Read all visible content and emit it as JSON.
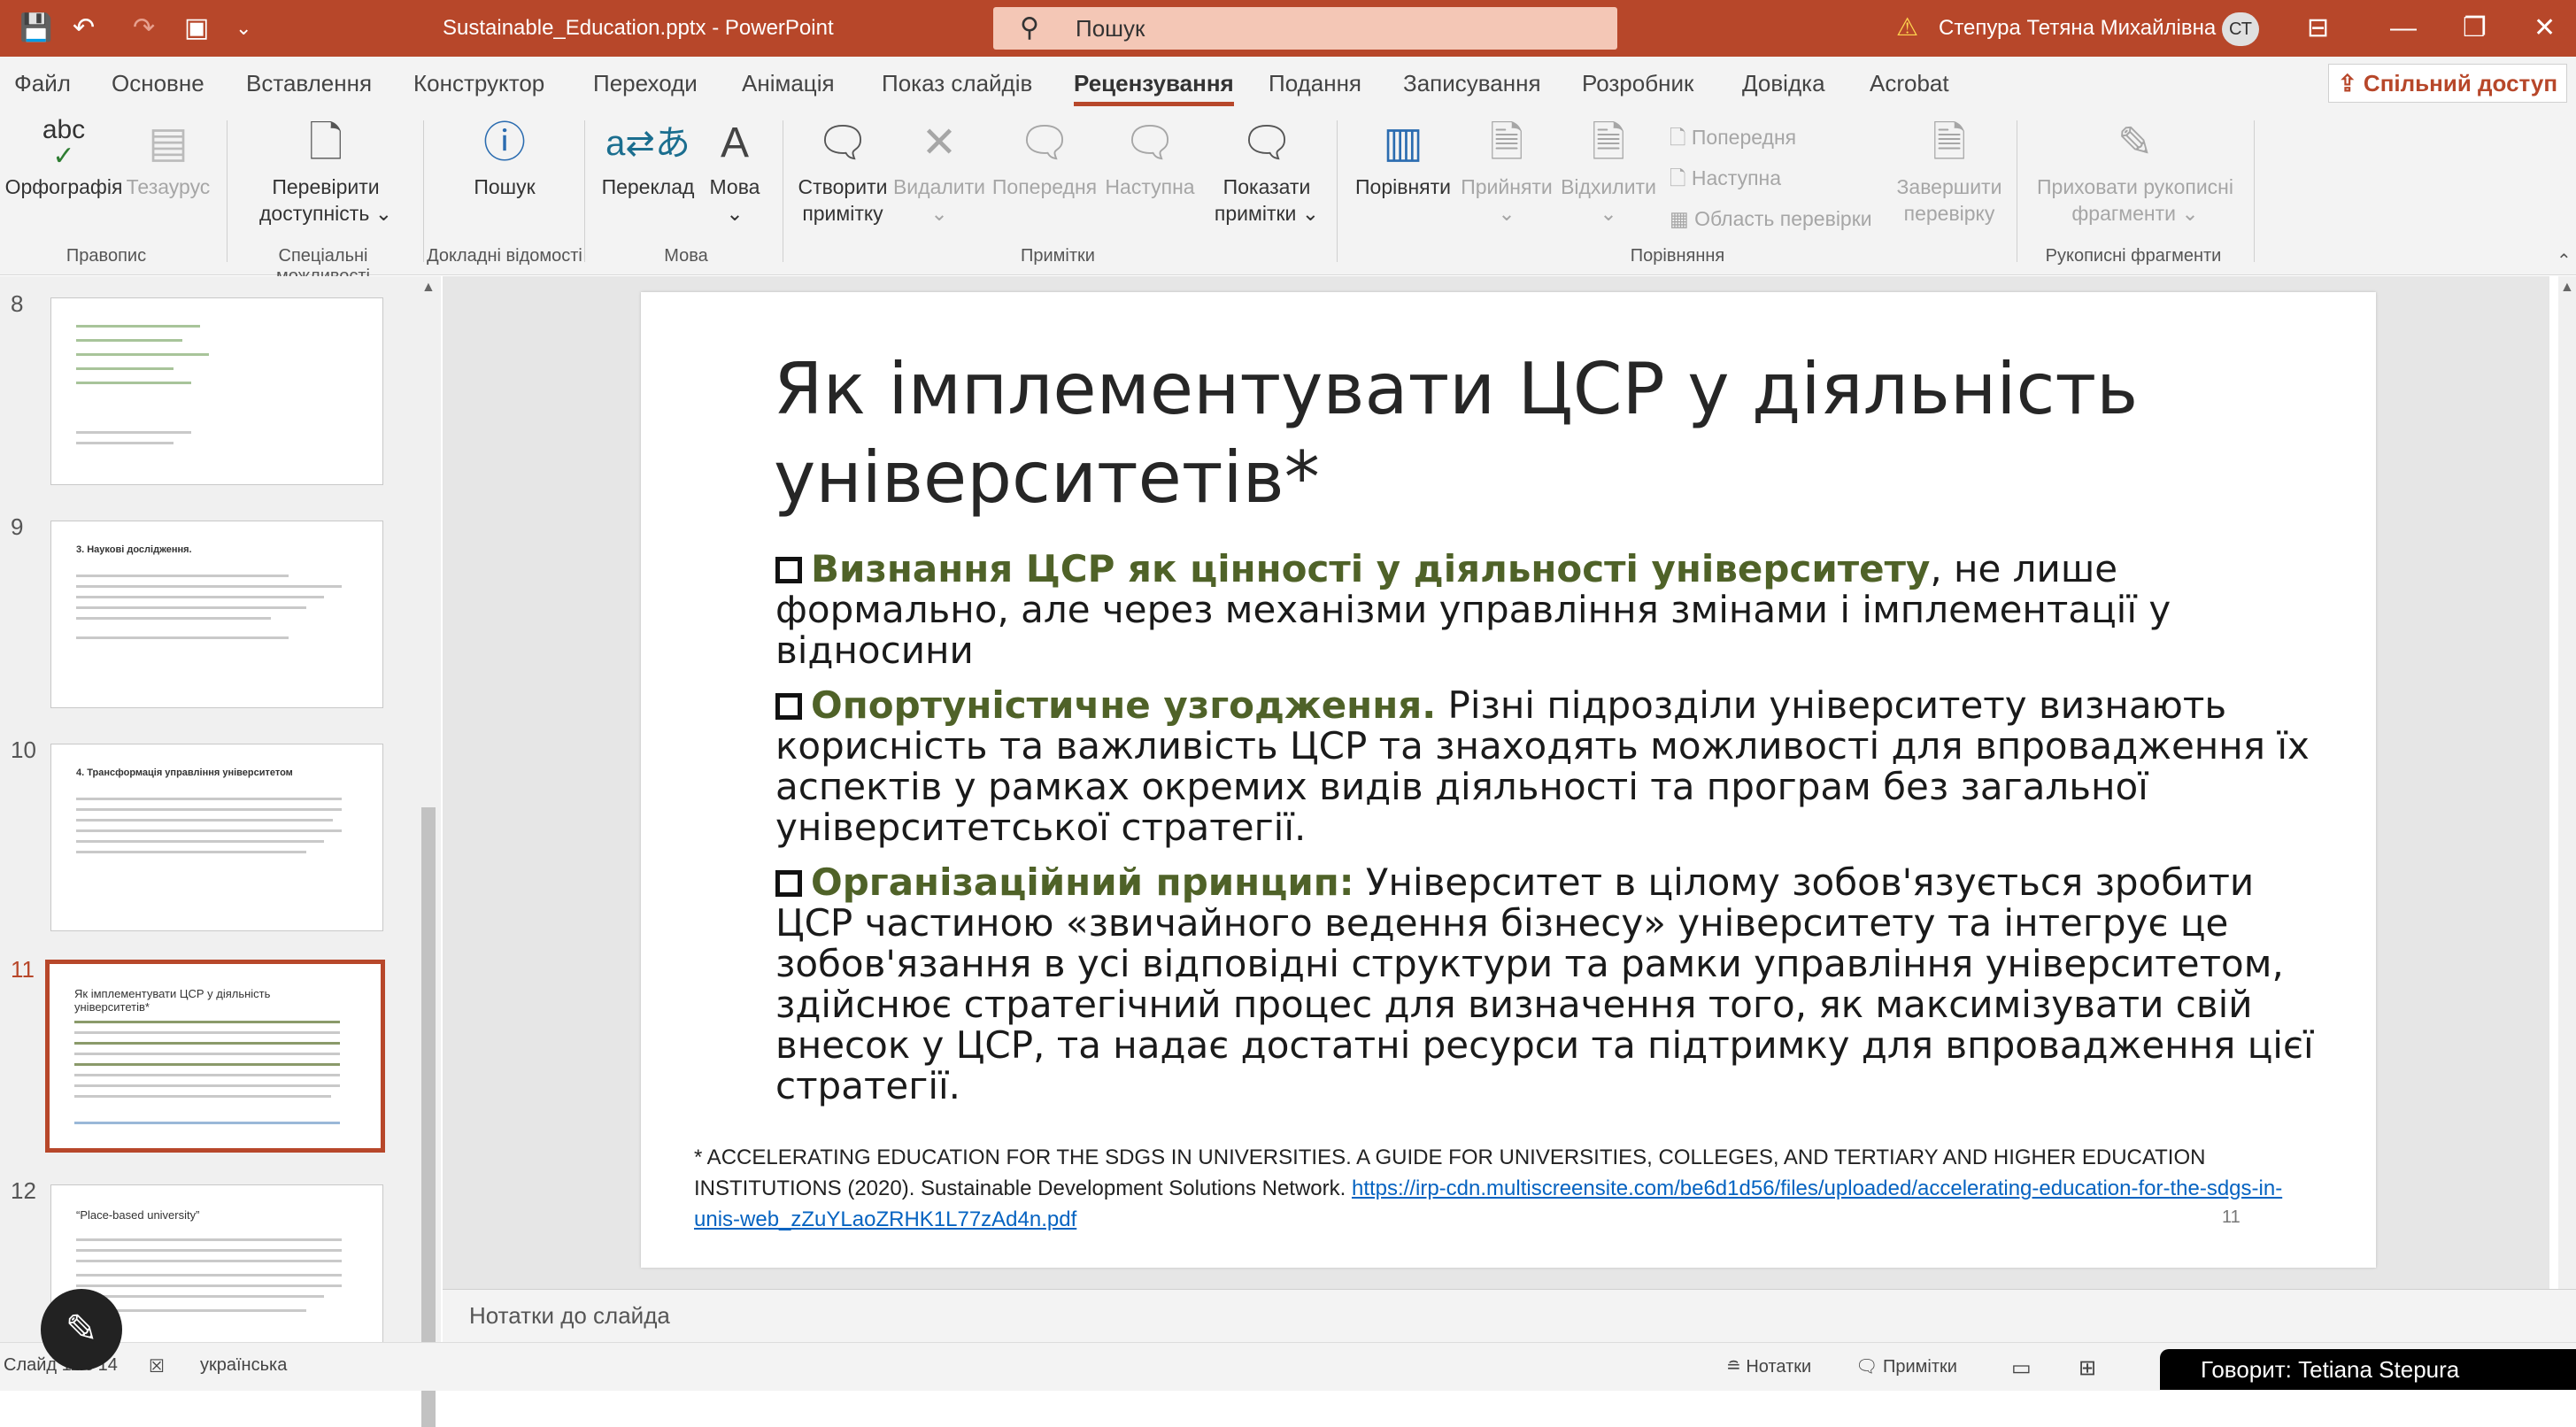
{
  "titlebar": {
    "qat": [
      "💾",
      "↶",
      "↷",
      "▣",
      "⌄"
    ],
    "document_title": "Sustainable_Education.pptx - PowerPoint",
    "search_placeholder": "Пошук",
    "user_name": "Степура Тетяна Михайлівна",
    "avatar_initials": "СТ"
  },
  "tabs": [
    "Файл",
    "Основне",
    "Вставлення",
    "Конструктор",
    "Переходи",
    "Анімація",
    "Показ слайдів",
    "Рецензування",
    "Подання",
    "Записування",
    "Розробник",
    "Довідка",
    "Acrobat"
  ],
  "active_tab": "Рецензування",
  "share_label": "Спільний доступ",
  "ribbon": {
    "spelling": "Орфографія",
    "thesaurus": "Тезаурус",
    "accessibility_1": "Перевірити",
    "accessibility_2": "доступність",
    "search": "Пошук",
    "translate": "Переклад",
    "language": "Мова",
    "new_comment_1": "Створити",
    "new_comment_2": "примітку",
    "delete": "Видалити",
    "previous": "Попередня",
    "next": "Наступна",
    "show_comments_1": "Показати",
    "show_comments_2": "примітки",
    "compare": "Порівняти",
    "accept": "Прийняти",
    "reject": "Відхилити",
    "prev_small": "Попередня",
    "next_small": "Наступна",
    "review_pane": "Область перевірки",
    "end_review_1": "Завершити",
    "end_review_2": "перевірку",
    "hide_ink_1": "Приховати рукописні",
    "hide_ink_2": "фрагменти",
    "groups": {
      "proofing": "Правопис",
      "accessibility": "Спеціальні можливості",
      "insights": "Докладні відомості",
      "language": "Мова",
      "comments": "Примітки",
      "compare": "Порівняння",
      "ink": "Рукописні фрагменти"
    }
  },
  "thumbnails": [
    {
      "num": "8",
      "title": ""
    },
    {
      "num": "9",
      "title": "3. Наукові дослідження."
    },
    {
      "num": "10",
      "title": "4. Трансформація управління університетом"
    },
    {
      "num": "11",
      "title": "Як імплементувати ЦСР у діяльність університетів*"
    },
    {
      "num": "12",
      "title": "“Place-based university”"
    }
  ],
  "slide": {
    "title": "Як імплементувати ЦСР у діяльність університетів*",
    "bullets": [
      {
        "lead": "Визнання ЦСР як цінності у діяльності університету",
        "rest": ", не лише формально, але через механізми управління змінами і імплементації у відносини"
      },
      {
        "lead": "Опортуністичне узгодження.",
        "rest": " Різні підрозділи університету визнають корисність та важливість ЦСР та знаходять можливості для впровадження їх аспектів у рамках окремих видів діяльності та програм без загальної університетської стратегії."
      },
      {
        "lead": "Організаційний принцип:",
        "rest": " Університет в цілому зобов'язується зробити ЦСР частиною «звичайного ведення бізнесу» університету та інтегрує це зобов'язання в усі відповідні структури та рамки управління університетом, здійснює стратегічний процес для визначення того, як максимізувати свій внесок у ЦСР, та надає достатні ресурси та підтримку для впровадження цієї стратегії."
      }
    ],
    "footnote_text": "* ACCELERATING EDUCATION FOR THE SDGS IN UNIVERSITIES. A GUIDE FOR UNIVERSITIES, COLLEGES, AND TERTIARY AND HIGHER EDUCATION INSTITUTIONS (2020). Sustainable Development Solutions Network.  ",
    "footnote_link": "https://irp-cdn.multiscreensite.com/be6d1d56/files/uploaded/accelerating-education-for-the-sdgs-in-unis-web_zZuYLaoZRHK1L77zAd4n.pdf",
    "page_number": "11"
  },
  "notes_placeholder": "Нотатки до слайда",
  "status": {
    "slide_info": "Слайд 11 з 14",
    "language": "українська",
    "notes": "Нотатки",
    "comments": "Примітки"
  },
  "caption": "Говорит: Tetiana Stepura",
  "colors": {
    "accent": "#b7472a",
    "lead_green": "#4f6228",
    "link": "#0563c1"
  }
}
